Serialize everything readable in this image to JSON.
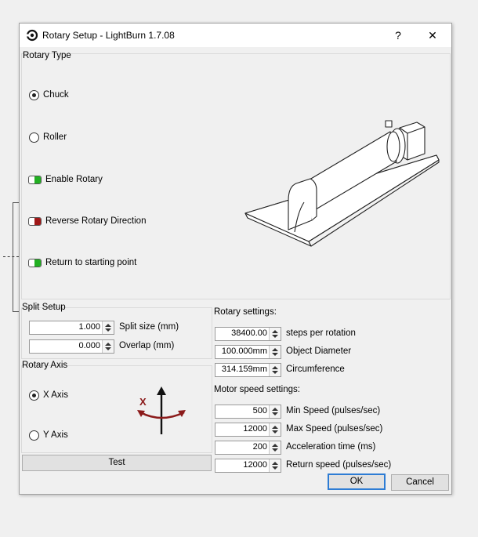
{
  "window": {
    "title": "Rotary Setup - LightBurn 1.7.08",
    "help_label": "?",
    "close_label": "✕"
  },
  "rotary_type": {
    "group_label": "Rotary Type",
    "options": [
      {
        "label": "Chuck",
        "checked": true
      },
      {
        "label": "Roller",
        "checked": false
      }
    ],
    "toggles": [
      {
        "label": "Enable Rotary",
        "on": true
      },
      {
        "label": "Reverse Rotary Direction",
        "on": false
      },
      {
        "label": "Return to starting point",
        "on": true
      }
    ]
  },
  "split_setup": {
    "group_label": "Split Setup",
    "fields": [
      {
        "value": "1.000",
        "label": "Split size (mm)"
      },
      {
        "value": "0.000",
        "label": "Overlap (mm)"
      }
    ]
  },
  "rotary_axis": {
    "group_label": "Rotary Axis",
    "options": [
      {
        "label": "X Axis",
        "checked": true
      },
      {
        "label": "Y Axis",
        "checked": false
      }
    ],
    "diagram_letter": "X"
  },
  "test_button": "Test",
  "rotary_settings": {
    "heading": "Rotary settings:",
    "fields": [
      {
        "value": "38400.00",
        "label": "steps per rotation"
      },
      {
        "value": "100.000mm",
        "label": "Object Diameter"
      },
      {
        "value": "314.159mm",
        "label": "Circumference"
      }
    ]
  },
  "motor_speed": {
    "heading": "Motor speed settings:",
    "fields": [
      {
        "value": "500",
        "label": "Min Speed (pulses/sec)"
      },
      {
        "value": "12000",
        "label": "Max Speed (pulses/sec)"
      },
      {
        "value": "200",
        "label": "Acceleration time (ms)"
      },
      {
        "value": "12000",
        "label": "Return speed (pulses/sec)"
      }
    ]
  },
  "buttons": {
    "ok": "OK",
    "cancel": "Cancel"
  },
  "colors": {
    "toggle_on": "#22b022",
    "toggle_off": "#a01818",
    "accent": "#2d7cd4",
    "arrow": "#8b1a1a"
  }
}
